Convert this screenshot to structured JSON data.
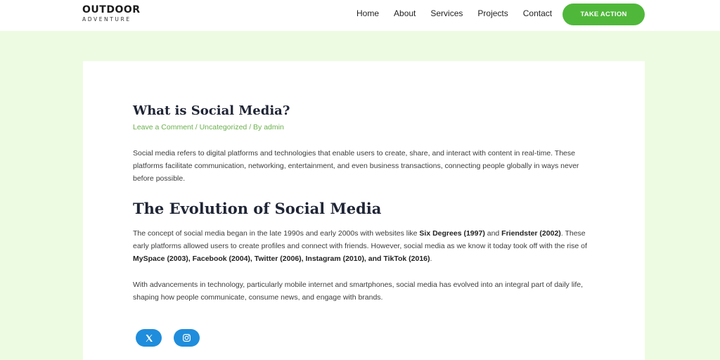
{
  "header": {
    "logo_main": "OUTDOOR",
    "logo_sub": "ADVENTURE",
    "nav": [
      "Home",
      "About",
      "Services",
      "Projects",
      "Contact"
    ],
    "cta_label": "TAKE ACTION"
  },
  "article": {
    "title": "What is Social Media?",
    "meta": {
      "comment_link": "Leave a Comment",
      "sep1": " / ",
      "category": "Uncategorized",
      "sep2": " / By ",
      "author": "admin"
    },
    "p1": "Social media refers to digital platforms and technologies that enable users to create, share, and interact with content in real-time. These platforms facilitate communication, networking, entertainment, and even business transactions, connecting people globally in ways never before possible.",
    "h2": "The Evolution of Social Media",
    "p2": {
      "t1": "The concept of social media began in the late 1990s and early 2000s with websites like ",
      "b1": "Six Degrees (1997)",
      "t2": " and ",
      "b2": "Friendster (2002)",
      "t3": ". These early platforms allowed users to create profiles and connect with friends. However, social media as we know it today took off with the rise of ",
      "b3": "MySpace (2003), Facebook (2004), Twitter (2006), Instagram (2010), and TikTok (2016)",
      "t4": "."
    },
    "p3": "With advancements in technology, particularly mobile internet and smartphones, social media has evolved into an integral part of daily life, shaping how people communicate, consume news, and engage with brands."
  },
  "social": {
    "icons": [
      "x-icon",
      "instagram-icon"
    ],
    "color": "#1f8ddc"
  },
  "colors": {
    "accent": "#4fb83a",
    "link": "#6ab04c",
    "page_bg": "#eefbe3"
  }
}
